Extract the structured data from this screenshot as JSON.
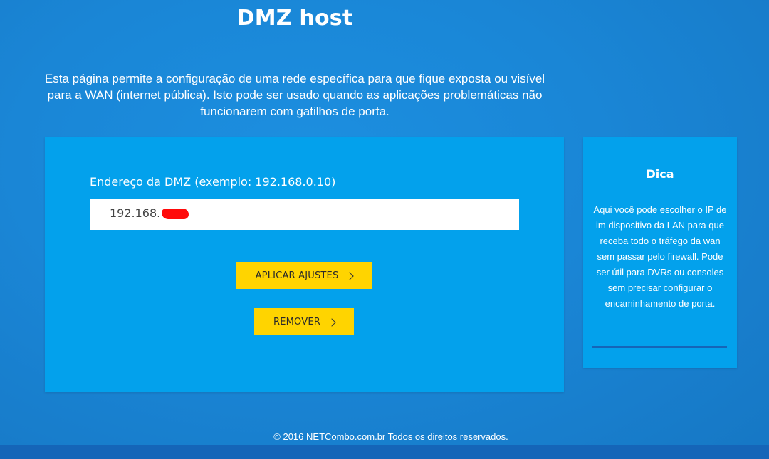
{
  "page": {
    "title": "DMZ host",
    "intro_line1": "Esta página permite a configuração de uma rede específica para que fique exposta ou visível",
    "intro_line2": "para a WAN (internet pública). Isto pode ser usado quando as aplicações problemáticas não",
    "intro_line3": "funcionarem com gatilhos de porta."
  },
  "form": {
    "dmz_label": "Endereço da DMZ (exemplo: 192.168.0.10)",
    "dmz_value": "192.168.",
    "apply_label": "APLICAR AJUSTES",
    "remove_label": "REMOVER"
  },
  "tip": {
    "title": "Dica",
    "text": "Aqui você pode escolher o IP de im dispositivo da LAN para que receba todo o tráfego da wan sem passar pelo firewall. Pode ser útil para DVRs ou consoles sem precisar configurar o encaminhamento de porta."
  },
  "footer": {
    "copyright": "© 2016 NETCombo.com.br Todos os direitos reservados."
  },
  "colors": {
    "background": "#1a86d6",
    "panel": "#03a1ec",
    "button": "#ffd400",
    "rule": "#1565b8",
    "redaction": "#ff0a0a"
  },
  "icons": {
    "button_chevron": "chevron-right-icon"
  }
}
